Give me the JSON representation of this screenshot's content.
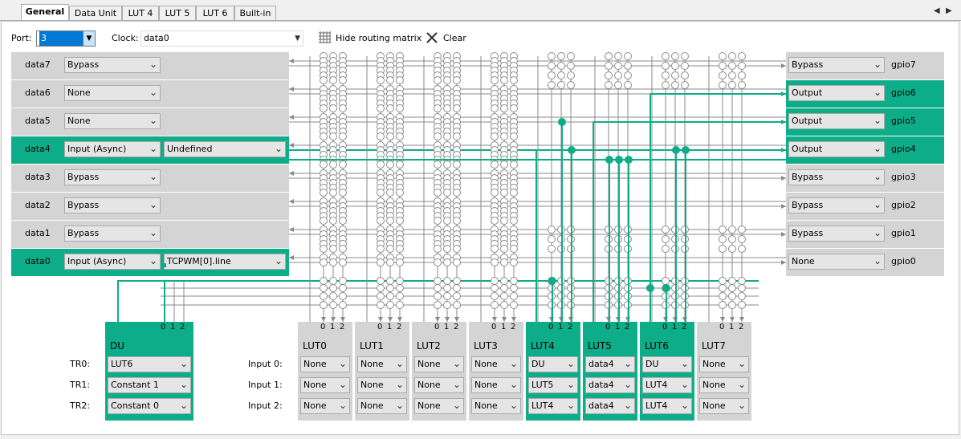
{
  "tabs": [
    "General",
    "Data Unit",
    "LUT 4",
    "LUT 5",
    "LUT 6",
    "Built-in"
  ],
  "toolbar": {
    "port_label": "Port:",
    "port_value": "3",
    "clock_label": "Clock:",
    "clock_value": "data0",
    "hide_matrix_label": "Hide routing matrix",
    "clear_label": "Clear"
  },
  "inputs": [
    {
      "name": "data7",
      "mode": "Bypass",
      "source": ""
    },
    {
      "name": "data6",
      "mode": "None",
      "source": ""
    },
    {
      "name": "data5",
      "mode": "None",
      "source": ""
    },
    {
      "name": "data4",
      "mode": "Input (Async)",
      "source": "Undefined"
    },
    {
      "name": "data3",
      "mode": "Bypass",
      "source": ""
    },
    {
      "name": "data2",
      "mode": "Bypass",
      "source": ""
    },
    {
      "name": "data1",
      "mode": "Bypass",
      "source": ""
    },
    {
      "name": "data0",
      "mode": "Input (Async)",
      "source": "TCPWM[0].line"
    }
  ],
  "outputs": [
    {
      "name": "gpio7",
      "mode": "Bypass"
    },
    {
      "name": "gpio6",
      "mode": "Output"
    },
    {
      "name": "gpio5",
      "mode": "Output"
    },
    {
      "name": "gpio4",
      "mode": "Output"
    },
    {
      "name": "gpio3",
      "mode": "Bypass"
    },
    {
      "name": "gpio2",
      "mode": "Bypass"
    },
    {
      "name": "gpio1",
      "mode": "Bypass"
    },
    {
      "name": "gpio0",
      "mode": "None"
    }
  ],
  "du": {
    "title": "DU",
    "tr_labels": [
      "TR0:",
      "TR1:",
      "TR2:"
    ],
    "tr_values": [
      "LUT6",
      "Constant 1",
      "Constant 0"
    ],
    "pins": [
      "0",
      "1",
      "2"
    ]
  },
  "lut_input_labels": [
    "Input 0:",
    "Input 1:",
    "Input 2:"
  ],
  "luts": [
    {
      "title": "LUT0",
      "inputs": [
        "None",
        "None",
        "None"
      ]
    },
    {
      "title": "LUT1",
      "inputs": [
        "None",
        "None",
        "None"
      ]
    },
    {
      "title": "LUT2",
      "inputs": [
        "None",
        "None",
        "None"
      ]
    },
    {
      "title": "LUT3",
      "inputs": [
        "None",
        "None",
        "None"
      ]
    },
    {
      "title": "LUT4",
      "inputs": [
        "DU",
        "LUT5",
        "LUT4"
      ]
    },
    {
      "title": "LUT5",
      "inputs": [
        "data4",
        "data4",
        "data4"
      ]
    },
    {
      "title": "LUT6",
      "inputs": [
        "DU",
        "LUT4",
        "LUT4"
      ]
    },
    {
      "title": "LUT7",
      "inputs": [
        "None",
        "None",
        "None"
      ]
    }
  ],
  "colors": {
    "active": "#0ead8a",
    "inactive": "#d4d4d4",
    "wire": "#8a8a8a"
  }
}
